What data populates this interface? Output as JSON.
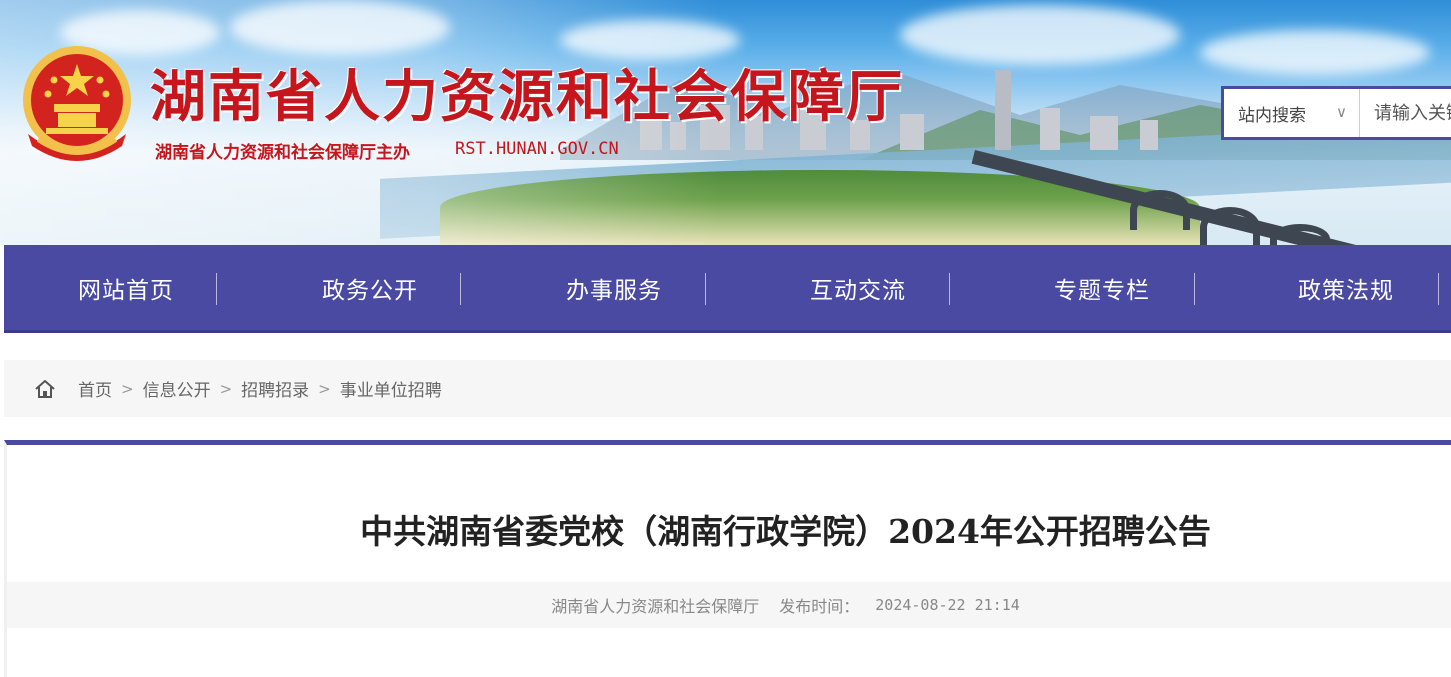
{
  "header": {
    "site_title": "湖南省人力资源和社会保障厅",
    "site_subtitle": "湖南省人力资源和社会保障厅主办",
    "site_domain": "RST.HUNAN.GOV.CN",
    "brand_color": "#c4161c"
  },
  "search": {
    "scope_label": "站内搜索",
    "placeholder": "请输入关键词"
  },
  "nav": {
    "items": [
      "网站首页",
      "政务公开",
      "办事服务",
      "互动交流",
      "专题专栏",
      "政策法规"
    ],
    "color": "#4a4aa3"
  },
  "breadcrumb": {
    "items": [
      "首页",
      "信息公开",
      "招聘招录",
      "事业单位招聘"
    ]
  },
  "article": {
    "title": "中共湖南省委党校（湖南行政学院）2024年公开招聘公告",
    "source": "湖南省人力资源和社会保障厅",
    "time_label": "发布时间：",
    "time_value": "2024-08-22 21:14"
  }
}
